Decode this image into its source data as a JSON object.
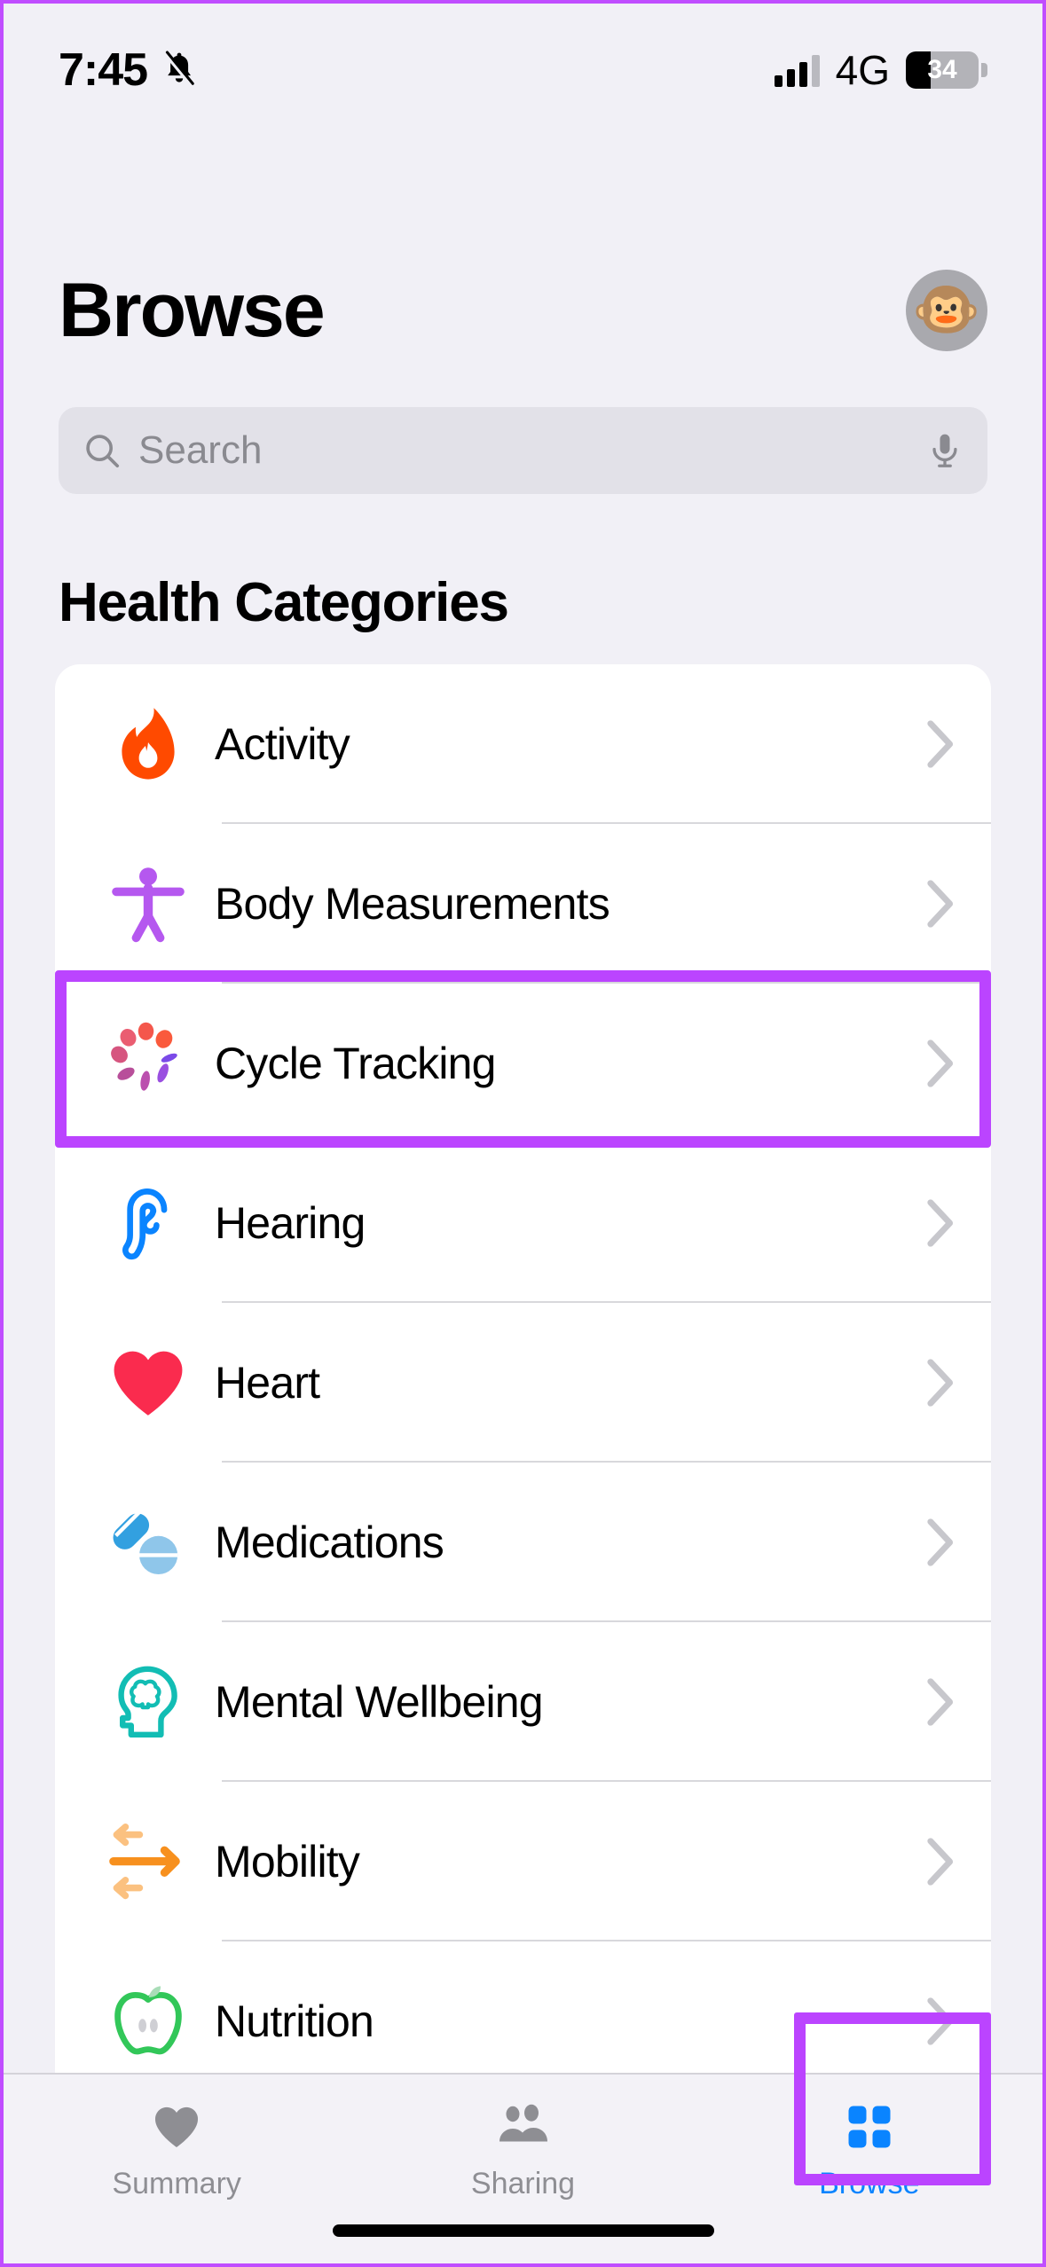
{
  "status_bar": {
    "time": "7:45",
    "silent_icon": "bell-slash-icon",
    "network": "4G",
    "battery_percent": "34",
    "battery_level": 34,
    "signal_icon": "cellular-signal-icon"
  },
  "header": {
    "title": "Browse",
    "avatar_emoji": "🐵",
    "avatar_name": "profile-avatar"
  },
  "search": {
    "placeholder": "Search",
    "value": "",
    "search_icon": "search-icon",
    "mic_icon": "microphone-icon"
  },
  "section": {
    "title": "Health Categories"
  },
  "categories": [
    {
      "label": "Activity",
      "icon": "flame-icon",
      "color": "#ff4a00"
    },
    {
      "label": "Body Measurements",
      "icon": "body-figure-icon",
      "color": "#b558ef"
    },
    {
      "label": "Cycle Tracking",
      "icon": "cycle-dots-icon",
      "color": "#f4574c",
      "highlighted": true
    },
    {
      "label": "Hearing",
      "icon": "ear-icon",
      "color": "#0a84ff"
    },
    {
      "label": "Heart",
      "icon": "heart-icon",
      "color": "#fa2b4e"
    },
    {
      "label": "Medications",
      "icon": "pills-icon",
      "color": "#32a0e0"
    },
    {
      "label": "Mental Wellbeing",
      "icon": "brain-head-icon",
      "color": "#12bdb4"
    },
    {
      "label": "Mobility",
      "icon": "arrows-icon",
      "color": "#f7901e"
    },
    {
      "label": "Nutrition",
      "icon": "apple-icon",
      "color": "#32c759"
    }
  ],
  "tabs": [
    {
      "label": "Summary",
      "icon": "heart-filled-icon",
      "active": false
    },
    {
      "label": "Sharing",
      "icon": "people-icon",
      "active": false
    },
    {
      "label": "Browse",
      "icon": "grid-squares-icon",
      "active": true
    }
  ],
  "colors": {
    "background": "#f1f0f6",
    "card": "#ffffff",
    "highlight": "#bb44ff",
    "accent": "#0a84ff",
    "inactive_tab": "#8e8e93",
    "chevron": "#c7c7cc"
  }
}
